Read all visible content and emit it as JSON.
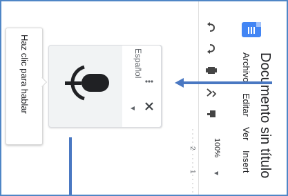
{
  "tooltip": {
    "text": "Haz clic para hablar"
  },
  "voice_panel": {
    "language": "Español",
    "more_icon": "more-vert-icon",
    "collapse_icon": "caret-icon",
    "close_icon": "close-icon",
    "mic_icon": "microphone-icon"
  },
  "document": {
    "title": "Documento sin título"
  },
  "menu": [
    "Archivo",
    "Editar",
    "Ver",
    "Insert"
  ],
  "toolbar": {
    "zoom": "100%",
    "icons": [
      "undo-icon",
      "redo-icon",
      "print-icon",
      "spellcheck-icon",
      "paint-format-icon"
    ]
  },
  "ruler": {
    "labels": [
      "2",
      "1"
    ]
  },
  "colors": {
    "accent_arrow": "#4a78c2",
    "docs_blue": "#4285f4"
  }
}
